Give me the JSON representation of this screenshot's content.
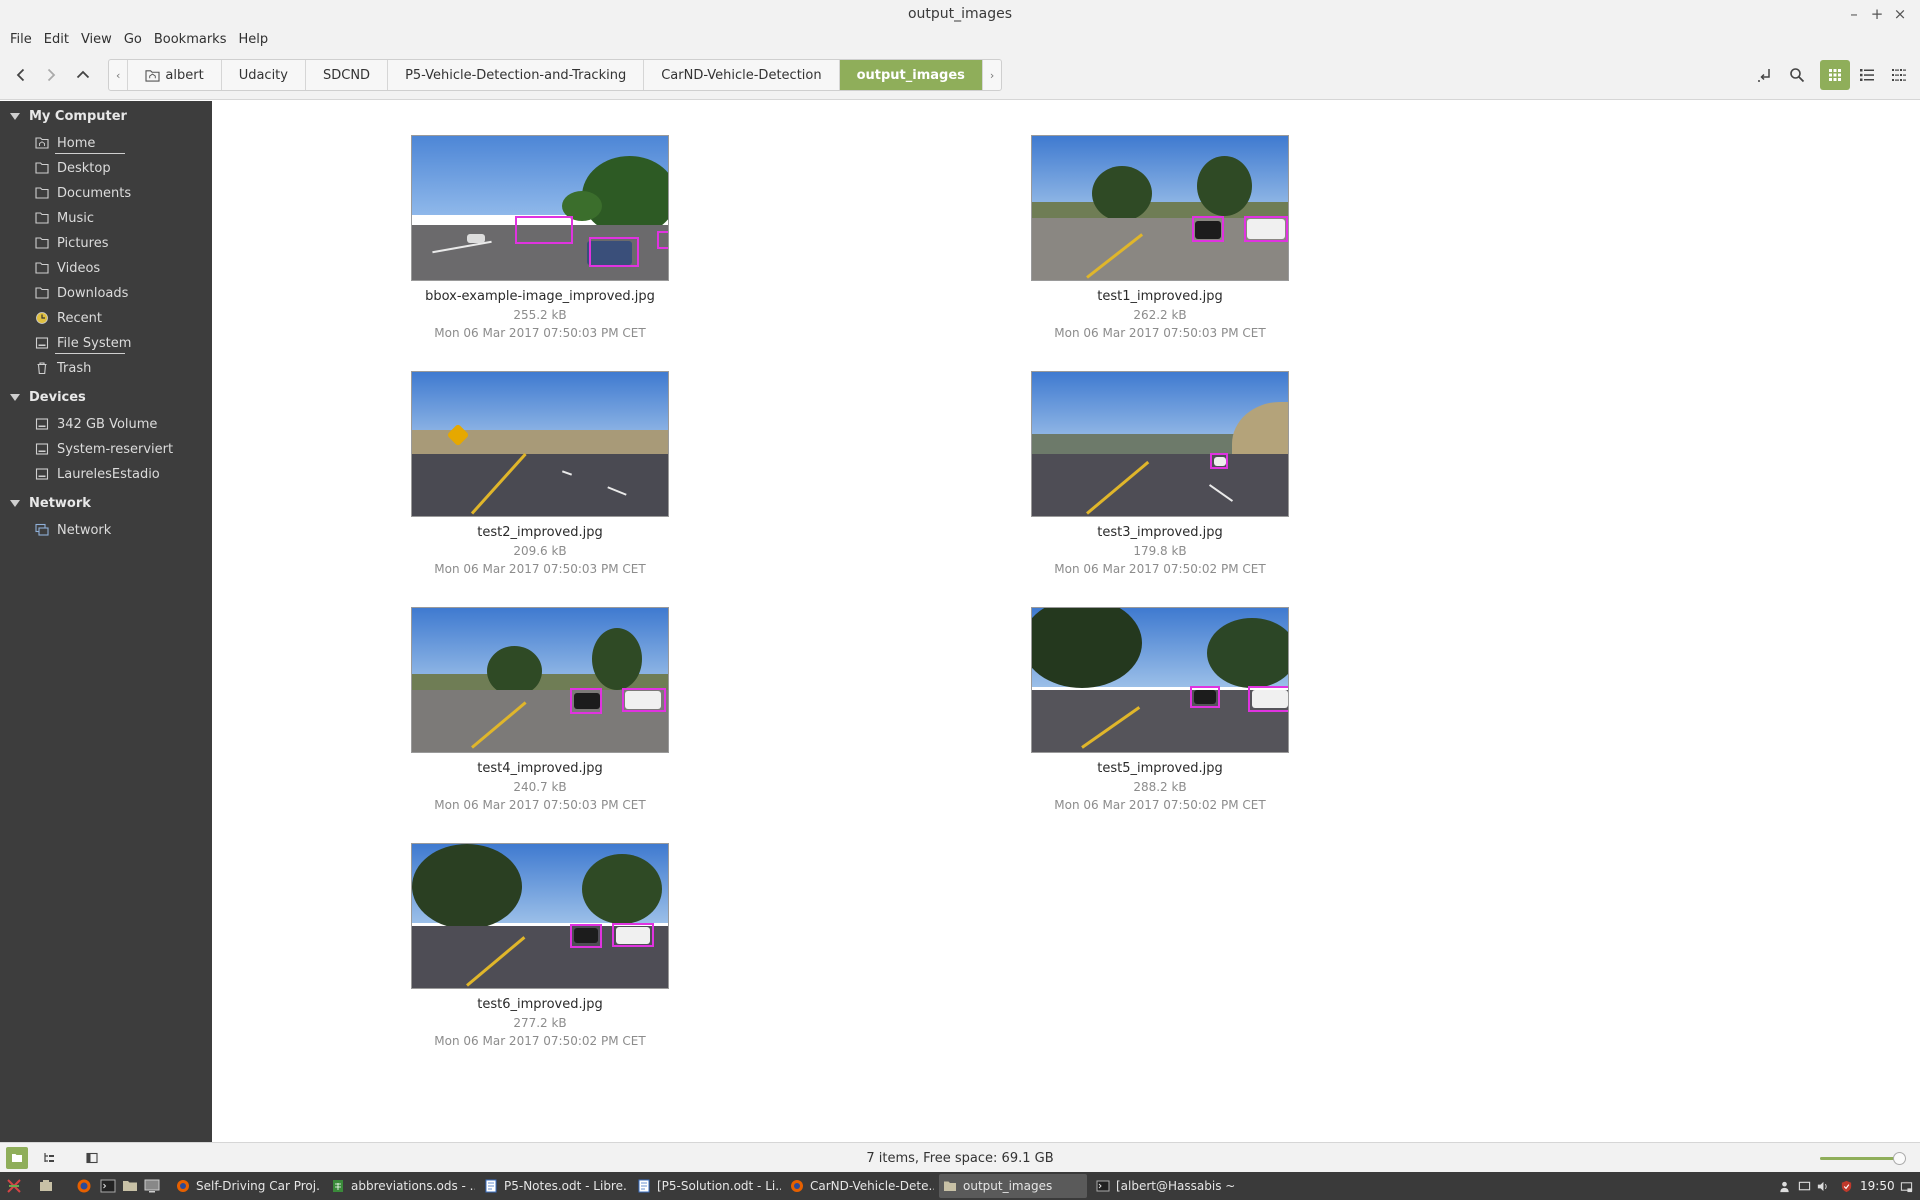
{
  "window": {
    "title": "output_images",
    "controls": [
      "minimize",
      "maximize",
      "close"
    ]
  },
  "menu": [
    "File",
    "Edit",
    "View",
    "Go",
    "Bookmarks",
    "Help"
  ],
  "breadcrumbs": [
    "albert",
    "Udacity",
    "SDCND",
    "P5-Vehicle-Detection-and-Tracking",
    "CarND-Vehicle-Detection",
    "output_images"
  ],
  "toolbar": {
    "back_icon": "chevron-left",
    "forward_icon": "chevron-right",
    "up_icon": "chevron-up",
    "active_view": "icon-view"
  },
  "sidebar": {
    "sections": [
      {
        "title": "My Computer",
        "items": [
          {
            "label": "Home",
            "icon": "home-folder"
          },
          {
            "label": "Desktop",
            "icon": "folder"
          },
          {
            "label": "Documents",
            "icon": "folder"
          },
          {
            "label": "Music",
            "icon": "folder"
          },
          {
            "label": "Pictures",
            "icon": "folder"
          },
          {
            "label": "Videos",
            "icon": "folder"
          },
          {
            "label": "Downloads",
            "icon": "folder"
          },
          {
            "label": "Recent",
            "icon": "clock"
          },
          {
            "label": "File System",
            "icon": "drive"
          },
          {
            "label": "Trash",
            "icon": "trash"
          }
        ]
      },
      {
        "title": "Devices",
        "items": [
          {
            "label": "342 GB Volume",
            "icon": "drive"
          },
          {
            "label": "System-reserviert",
            "icon": "drive"
          },
          {
            "label": "LaurelesEstadio",
            "icon": "drive"
          }
        ]
      },
      {
        "title": "Network",
        "items": [
          {
            "label": "Network",
            "icon": "network"
          }
        ]
      }
    ]
  },
  "files": [
    {
      "name": "bbox-example-image_improved.jpg",
      "size": "255.2 kB",
      "modified": "Mon 06 Mar 2017 07:50:03 PM CET"
    },
    {
      "name": "test1_improved.jpg",
      "size": "262.2 kB",
      "modified": "Mon 06 Mar 2017 07:50:03 PM CET"
    },
    {
      "name": "test2_improved.jpg",
      "size": "209.6 kB",
      "modified": "Mon 06 Mar 2017 07:50:03 PM CET"
    },
    {
      "name": "test3_improved.jpg",
      "size": "179.8 kB",
      "modified": "Mon 06 Mar 2017 07:50:02 PM CET"
    },
    {
      "name": "test4_improved.jpg",
      "size": "240.7 kB",
      "modified": "Mon 06 Mar 2017 07:50:03 PM CET"
    },
    {
      "name": "test5_improved.jpg",
      "size": "288.2 kB",
      "modified": "Mon 06 Mar 2017 07:50:02 PM CET"
    },
    {
      "name": "test6_improved.jpg",
      "size": "277.2 kB",
      "modified": "Mon 06 Mar 2017 07:50:02 PM CET"
    }
  ],
  "status": {
    "text": "7 items, Free space: 69.1 GB",
    "zoom_level": 0.92
  },
  "taskbar": {
    "tasks": [
      {
        "label": "Self-Driving Car Proj...",
        "icon": "firefox"
      },
      {
        "label": "abbreviations.ods - ...",
        "icon": "spreadsheet"
      },
      {
        "label": "P5-Notes.odt - Libre...",
        "icon": "document"
      },
      {
        "label": "[P5-Solution.odt - Li...",
        "icon": "document"
      },
      {
        "label": "CarND-Vehicle-Dete...",
        "icon": "firefox"
      },
      {
        "label": "output_images",
        "icon": "folder"
      },
      {
        "label": "[albert@Hassabis ~",
        "icon": "terminal"
      }
    ],
    "clock": "19:50"
  },
  "colors": {
    "accent": "#8fae5a",
    "sidebar_bg": "#3d3d3d",
    "detection_box": "#e033e0"
  }
}
